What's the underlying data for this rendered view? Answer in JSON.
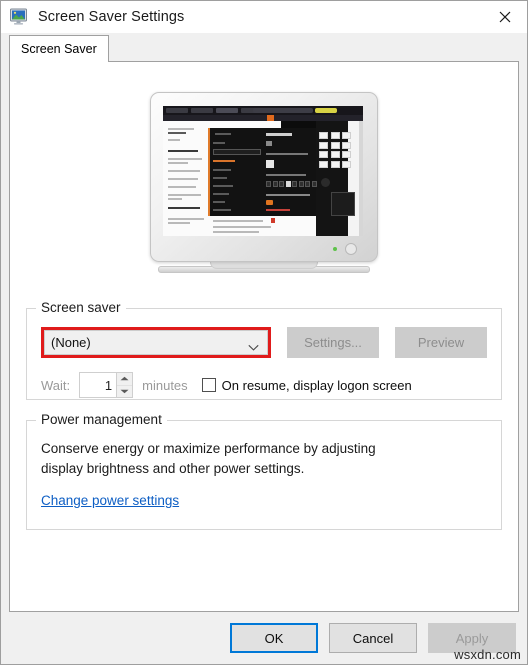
{
  "window": {
    "title": "Screen Saver Settings",
    "icon": "display-monitor-icon",
    "close_label": "✕"
  },
  "tabs": [
    {
      "label": "Screen Saver",
      "selected": true
    }
  ],
  "preview": {
    "alt": "monitor-preview-thumbnail",
    "led_color": "#5ec24a"
  },
  "screen_saver_group": {
    "label": "Screen saver",
    "combo": {
      "value": "(None)",
      "highlight_color": "#e01b1b",
      "arrow_icon": "chevron-down-icon"
    },
    "settings_button": {
      "label": "Settings...",
      "disabled": true
    },
    "preview_button": {
      "label": "Preview",
      "disabled": true
    },
    "wait_label": "Wait:",
    "wait_value": "1",
    "minutes_label": "minutes",
    "on_resume": {
      "label": "On resume, display logon screen",
      "checked": false
    }
  },
  "power_group": {
    "label": "Power management",
    "description_line1": "Conserve energy or maximize performance by adjusting",
    "description_line2": "display brightness and other power settings.",
    "link": "Change power settings",
    "link_color": "#0d5ec4"
  },
  "footer": {
    "ok": {
      "label": "OK",
      "default": true
    },
    "cancel": {
      "label": "Cancel"
    },
    "apply": {
      "label": "Apply",
      "disabled": true
    }
  },
  "watermark": "wsxdn.com"
}
